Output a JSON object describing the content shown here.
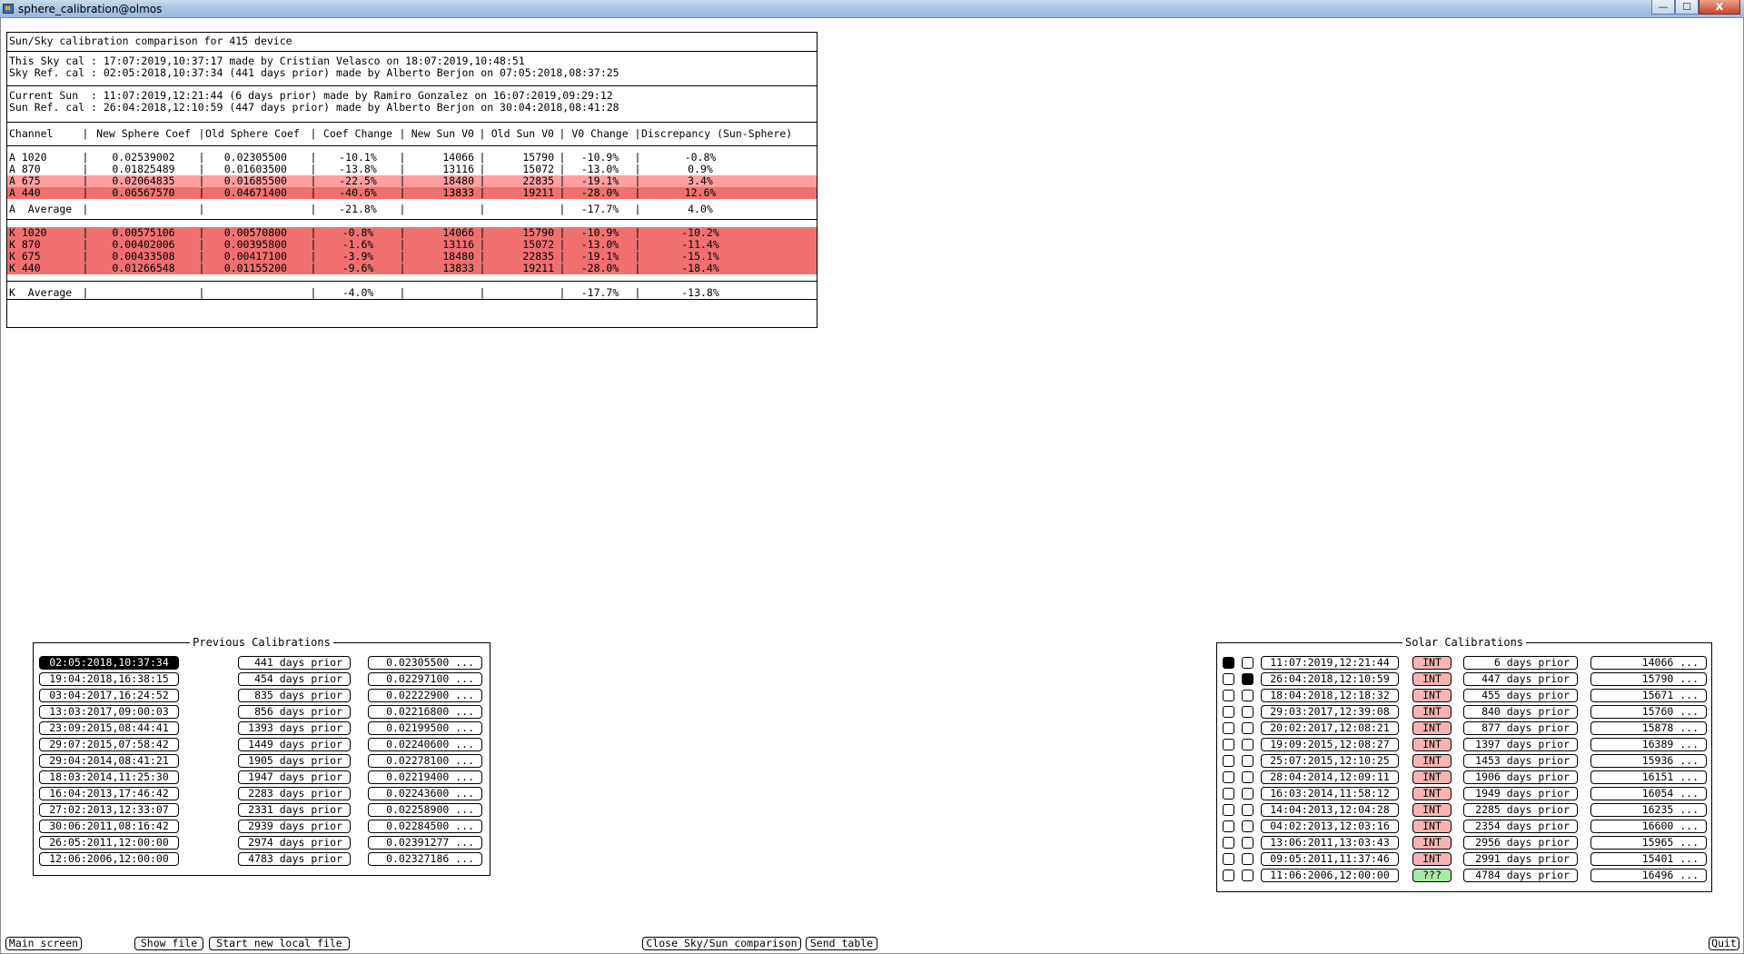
{
  "window": {
    "title": "sphere_calibration@olmos",
    "minimize": "—",
    "maximize": "☐",
    "close": "X"
  },
  "comparison": {
    "title": "Sun/Sky calibration comparison for 415 device",
    "sky_lines": [
      "This Sky cal : 17:07:2019,10:37:17 made by Cristian Velasco on 18:07:2019,10:48:51",
      "Sky Ref. cal : 02:05:2018,10:37:34 (441 days prior) made by Alberto Berjon on 07:05:2018,08:37:25"
    ],
    "sun_lines": [
      "Current Sun  : 11:07:2019,12:21:44 (6 days prior) made by Ramiro Gonzalez on 16:07:2019,09:29:12",
      "Sun Ref. cal : 26:04:2018,12:10:59 (447 days prior) made by Alberto Berjon on 30:04:2018,08:41:28"
    ],
    "headers": [
      "Channel",
      "New Sphere Coef",
      "Old Sphere Coef",
      "Coef Change",
      "New Sun V0",
      "Old Sun V0",
      "V0 Change",
      "Discrepancy (Sun-Sphere)"
    ],
    "separator": "|",
    "a_rows": [
      [
        "A 1020",
        "0.02539002",
        "0.02305500",
        "-10.1%",
        "14066",
        "15790",
        "-10.9%",
        "-0.8%"
      ],
      [
        "A 870",
        "0.01825489",
        "0.01603500",
        "-13.8%",
        "13116",
        "15072",
        "-13.0%",
        "0.9%"
      ],
      [
        "A 675",
        "0.02064835",
        "0.01685500",
        "-22.5%",
        "18480",
        "22835",
        "-19.1%",
        "3.4%"
      ],
      [
        "A 440",
        "0.06567570",
        "0.04671400",
        "-40.6%",
        "13833",
        "19211",
        "-28.0%",
        "12.6%"
      ]
    ],
    "a_average": [
      "A  Average",
      "",
      "",
      "-21.8%",
      "",
      "",
      "-17.7%",
      "4.0%"
    ],
    "k_rows": [
      [
        "K 1020",
        "0.00575106",
        "0.00570800",
        "-0.8%",
        "14066",
        "15790",
        "-10.9%",
        "-10.2%"
      ],
      [
        "K 870",
        "0.00402006",
        "0.00395800",
        "-1.6%",
        "13116",
        "15072",
        "-13.0%",
        "-11.4%"
      ],
      [
        "K 675",
        "0.00433508",
        "0.00417100",
        "-3.9%",
        "18480",
        "22835",
        "-19.1%",
        "-15.1%"
      ],
      [
        "K 440",
        "0.01266548",
        "0.01155200",
        "-9.6%",
        "13833",
        "19211",
        "-28.0%",
        "-18.4%"
      ]
    ],
    "k_average": [
      "K  Average",
      "",
      "",
      "-4.0%",
      "",
      "",
      "-17.7%",
      "-13.8%"
    ]
  },
  "previous": {
    "title": "Previous Calibrations",
    "rows": [
      [
        "02:05:2018,10:37:34",
        "441 days prior",
        "0.02305500 ..."
      ],
      [
        "19:04:2018,16:38:15",
        "454 days prior",
        "0.02297100 ..."
      ],
      [
        "03:04:2017,16:24:52",
        "835 days prior",
        "0.02222900 ..."
      ],
      [
        "13:03:2017,09:00:03",
        "856 days prior",
        "0.02216800 ..."
      ],
      [
        "23:09:2015,08:44:41",
        "1393 days prior",
        "0.02199500 ..."
      ],
      [
        "29:07:2015,07:58:42",
        "1449 days prior",
        "0.02240600 ..."
      ],
      [
        "29:04:2014,08:41:21",
        "1905 days prior",
        "0.02278100 ..."
      ],
      [
        "18:03:2014,11:25:30",
        "1947 days prior",
        "0.02219400 ..."
      ],
      [
        "16:04:2013,17:46:42",
        "2283 days prior",
        "0.02243600 ..."
      ],
      [
        "27:02:2013,12:33:07",
        "2331 days prior",
        "0.02258900 ..."
      ],
      [
        "30:06:2011,08:16:42",
        "2939 days prior",
        "0.02284500 ..."
      ],
      [
        "26:05:2011,12:00:00",
        "2974 days prior",
        "0.02391277 ..."
      ],
      [
        "12:06:2006,12:00:00",
        "4783 days prior",
        "0.02327186 ..."
      ]
    ]
  },
  "solar": {
    "title": "Solar Calibrations",
    "rows": [
      [
        "11:07:2019,12:21:44",
        "INT",
        "6 days prior",
        "14066 ..."
      ],
      [
        "26:04:2018,12:10:59",
        "INT",
        "447 days prior",
        "15790 ..."
      ],
      [
        "18:04:2018,12:18:32",
        "INT",
        "455 days prior",
        "15671 ..."
      ],
      [
        "29:03:2017,12:39:08",
        "INT",
        "840 days prior",
        "15760 ..."
      ],
      [
        "20:02:2017,12:08:21",
        "INT",
        "877 days prior",
        "15878 ..."
      ],
      [
        "19:09:2015,12:08:27",
        "INT",
        "1397 days prior",
        "16389 ..."
      ],
      [
        "25:07:2015,12:10:25",
        "INT",
        "1453 days prior",
        "15936 ..."
      ],
      [
        "28:04:2014,12:09:11",
        "INT",
        "1906 days prior",
        "16151 ..."
      ],
      [
        "16:03:2014,11:58:12",
        "INT",
        "1949 days prior",
        "16054 ..."
      ],
      [
        "14:04:2013,12:04:28",
        "INT",
        "2285 days prior",
        "16235 ..."
      ],
      [
        "04:02:2013,12:03:16",
        "INT",
        "2354 days prior",
        "16600 ..."
      ],
      [
        "13:06:2011,13:03:43",
        "INT",
        "2956 days prior",
        "15965 ..."
      ],
      [
        "09:05:2011,11:37:46",
        "INT",
        "2991 days prior",
        "15401 ..."
      ],
      [
        "11:06:2006,12:00:00",
        "???",
        "4784 days prior",
        "16496 ..."
      ]
    ]
  },
  "buttons": {
    "main_screen": "Main screen",
    "show_file": "Show file",
    "start_new_local_file": "Start new local file",
    "close_comparison": "Close Sky/Sun comparison",
    "send_table": "Send table",
    "quit": "Quit"
  }
}
